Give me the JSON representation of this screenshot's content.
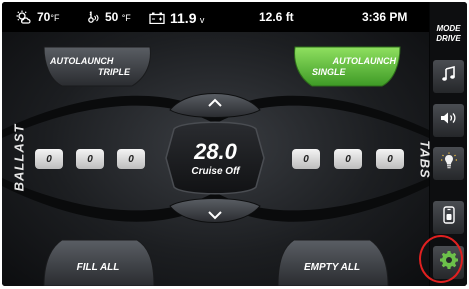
{
  "status_bar": {
    "air_temp": "70",
    "air_temp_unit": "°F",
    "water_temp": "50",
    "water_temp_unit": "°F",
    "battery": "11.9",
    "battery_unit": "v",
    "depth": "12.6 ft",
    "time": "3:36 PM"
  },
  "sidebar": {
    "mode_line1": "MODE",
    "mode_line2": "DRIVE"
  },
  "main": {
    "autolaunch_triple_line1": "AUTOLAUNCH",
    "autolaunch_triple_line2": "TRIPLE",
    "autolaunch_single_line1": "AUTOLAUNCH",
    "autolaunch_single_line2": "SINGLE",
    "ballast_label": "BALLAST",
    "tabs_label": "TABS",
    "ballast_values": [
      "0",
      "0",
      "0"
    ],
    "tabs_values": [
      "0",
      "0",
      "0"
    ],
    "speed_value": "28.0",
    "cruise_status": "Cruise Off",
    "fill_all": "FILL ALL",
    "empty_all": "EMPTY ALL"
  },
  "colors": {
    "active_green": "#5cc23a",
    "settings_icon": "#6cc04a",
    "highlight_circle": "#e02020"
  }
}
